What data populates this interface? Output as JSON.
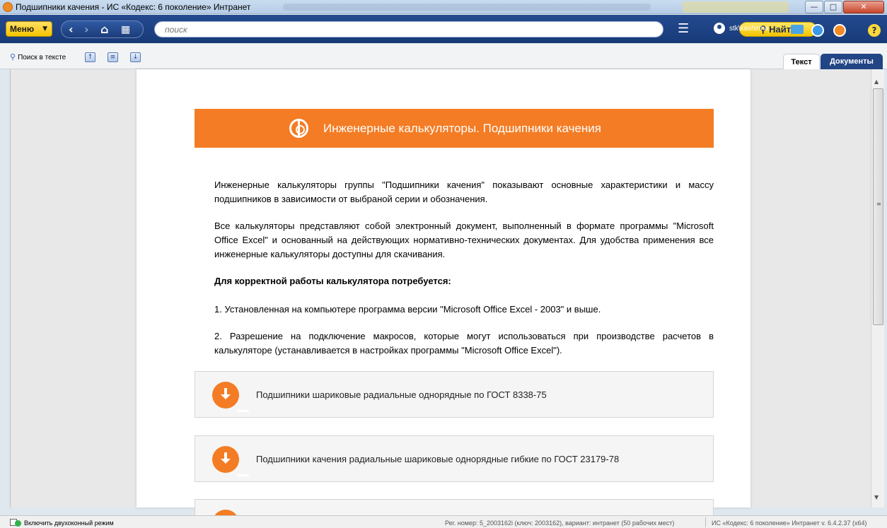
{
  "window": {
    "title": "Подшипники качения - ИС «Кодекс: 6 поколение» Интранет",
    "controls": {
      "minimize": "—",
      "maximize": "□",
      "close": "✕"
    }
  },
  "toolbar": {
    "menu_label": "Меню",
    "search_placeholder": "поиск",
    "find_label": "Найти",
    "user_name": "stk\\kashirina"
  },
  "subbar": {
    "find_in_text": "Поиск в тексте",
    "tabs": [
      {
        "label": "Текст",
        "active": true
      },
      {
        "label": "Документы",
        "active": false
      }
    ]
  },
  "document": {
    "banner_title": "Инженерные калькуляторы. Подшипники качения",
    "paragraphs": [
      "Инженерные калькуляторы группы \"Подшипники качения\" показывают основные характеристики и массу подшипников в зависимости от выбраной серии и обозначения.",
      "Все калькуляторы представляют собой электронный документ, выполненный в формате программы \"Microsoft Office Excel\" и основанный на действующих нормативно-технических документах. Для удобства применения все инженерные калькуляторы доступны для скачивания.",
      "Для корректной работы калькулятора потребуется:",
      "1. Установленная на компьютере программа версии \"Microsoft Office Excel - 2003\" и выше.",
      "2. Разрешение на подключение макросов, которые могут использоваться при производстве расчетов в калькуляторе (устанавливается в настройках программы \"Microsoft Office Excel\")."
    ],
    "downloads": [
      "Подшипники шариковые радиальные однорядные по ГОСТ 8338-75",
      "Подшипники качения радиальные шариковые однорядные гибкие по ГОСТ 23179-78"
    ]
  },
  "statusbar": {
    "dual_window": "Включить двухоконный режим",
    "registration": "Рег. номер: 5_2003162i (ключ: 2003162), вариант: интранет (50 рабочих мест)",
    "version": "ИС «Кодекс: 6 поколение» Интранет v. 6.4.2.37 (x64)"
  },
  "colors": {
    "accent_orange": "#f47c24",
    "toolbar_blue": "#1d4283",
    "button_yellow": "#f5c400"
  }
}
